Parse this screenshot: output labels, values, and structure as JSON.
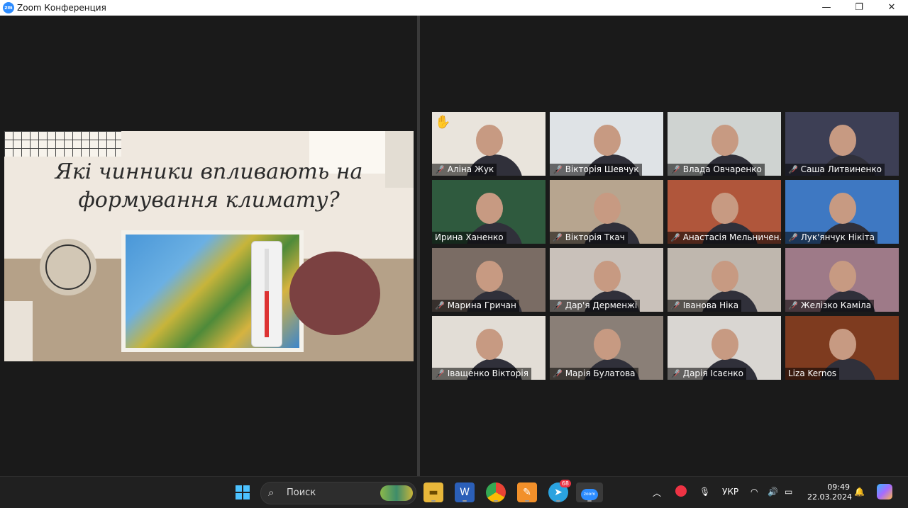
{
  "window": {
    "title": "Zoom Конференция",
    "app_icon": "zm",
    "controls": {
      "minimize": "—",
      "maximize": "❐",
      "close": "✕"
    }
  },
  "presentation": {
    "question_line1": "Які чинники впливають на",
    "question_line2": "формування климату?"
  },
  "participants": [
    {
      "name": "Аліна Жук",
      "muted": true,
      "hand_raised": true
    },
    {
      "name": "Вікторія Шевчук",
      "muted": true
    },
    {
      "name": "Влада Овчаренко",
      "muted": true
    },
    {
      "name": "Саша Литвиненко",
      "muted": true
    },
    {
      "name": "Ирина Ханенко",
      "muted": false,
      "active_speaker": true
    },
    {
      "name": "Вікторія Ткач",
      "muted": true
    },
    {
      "name": "Анастасія Мельничен...",
      "muted": true
    },
    {
      "name": "Лук'янчук Нікіта",
      "muted": true
    },
    {
      "name": "Марина Гричан",
      "muted": true
    },
    {
      "name": "Дар'я Дерменжі",
      "muted": true
    },
    {
      "name": "Іванова Ніка",
      "muted": true
    },
    {
      "name": "Желізко Каміла",
      "muted": true
    },
    {
      "name": "Іващенко Вікторія",
      "muted": true
    },
    {
      "name": "Марія Булатова",
      "muted": true
    },
    {
      "name": "Дарія Ісаєнко",
      "muted": true
    },
    {
      "name": "Liza Kernos",
      "muted": false
    }
  ],
  "taskbar": {
    "search_label": "Поиск",
    "telegram_badge": "68",
    "language": "УКР",
    "time": "09:49",
    "date": "22.03.2024"
  }
}
